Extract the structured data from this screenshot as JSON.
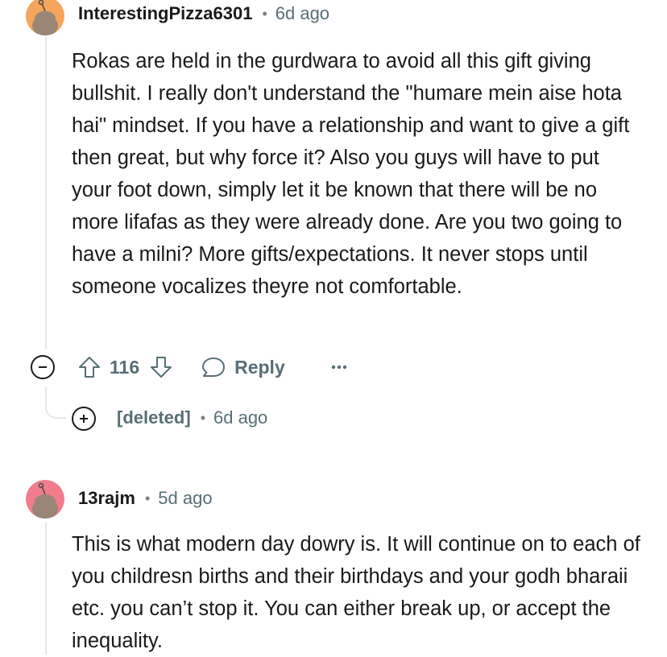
{
  "comments": [
    {
      "username": "InterestingPizza6301",
      "separator": "•",
      "time": "6d ago",
      "avatar_color": "#f5a55e",
      "body": "Rokas are held in the gurdwara to avoid all this gift giving bullshit. I really don't understand the \"humare mein aise hota hai\" mindset. If you have a relationship and want to give a gift then great, but why force it? Also you guys will have to put your foot down, simply let it be known that there will be no more lifafas as they were already done. Are you two going to have a milni? More gifts/expectations. It never stops until someone vocalizes theyre not comfortable.",
      "actions": {
        "collapse_icon": "minus-circle-icon",
        "upvote_icon": "upvote-arrow-icon",
        "vote_count": "116",
        "downvote_icon": "downvote-arrow-icon",
        "reply_icon": "speech-bubble-icon",
        "reply_label": "Reply",
        "more_icon": "ellipsis-icon"
      },
      "collapsed_reply": {
        "expand_icon": "plus-circle-icon",
        "username": "[deleted]",
        "separator": "•",
        "time": "6d ago"
      }
    },
    {
      "username": "13rajm",
      "separator": "•",
      "time": "5d ago",
      "avatar_color": "#f07c8c",
      "body": "This is what modern day dowry is. It will continue on to each of you childresn births and their birthdays and your godh bharaii etc. you can’t stop it. You can either break up, or accept the inequality."
    }
  ],
  "colors": {
    "text": "#1a1a1b",
    "meta": "#576f76",
    "thread_line": "#e5e7eb"
  }
}
